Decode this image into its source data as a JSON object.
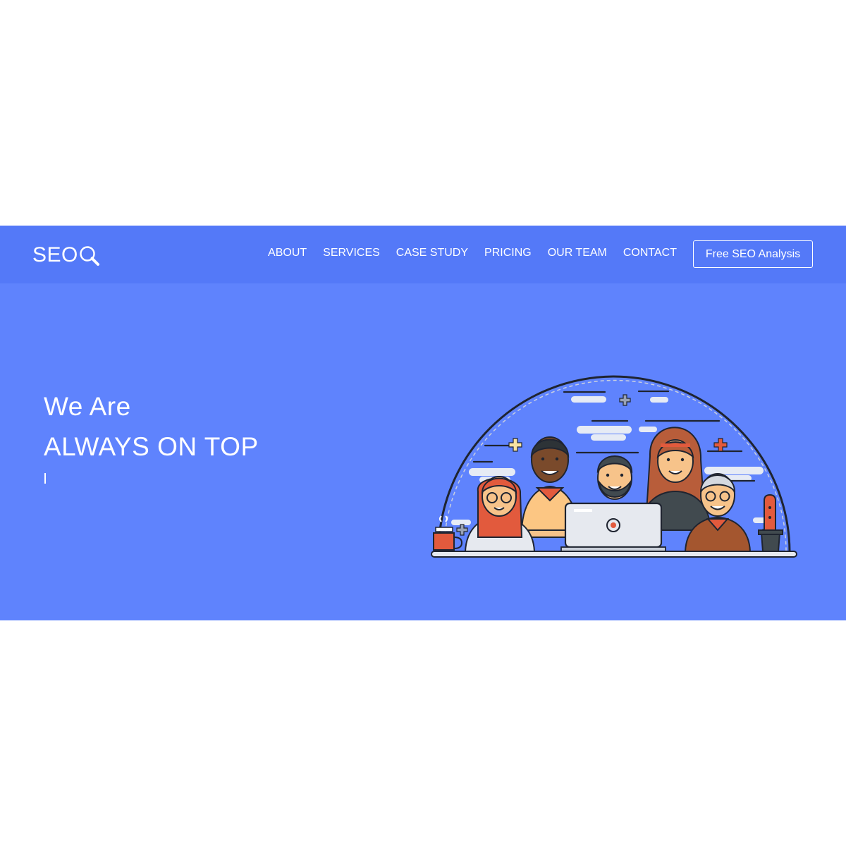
{
  "brand": {
    "logo_text": "SEO",
    "logo_icon": "magnifier-icon"
  },
  "nav": {
    "links": [
      "ABOUT",
      "SERVICES",
      "CASE STUDY",
      "PRICING",
      "OUR TEAM",
      "CONTACT"
    ],
    "cta_label": "Free SEO Analysis"
  },
  "hero": {
    "line1": "We Are",
    "line2": "ALWAYS ON TOP"
  },
  "colors": {
    "navbar": "#5479f8",
    "hero": "#5f83fd",
    "text": "#ffffff"
  }
}
